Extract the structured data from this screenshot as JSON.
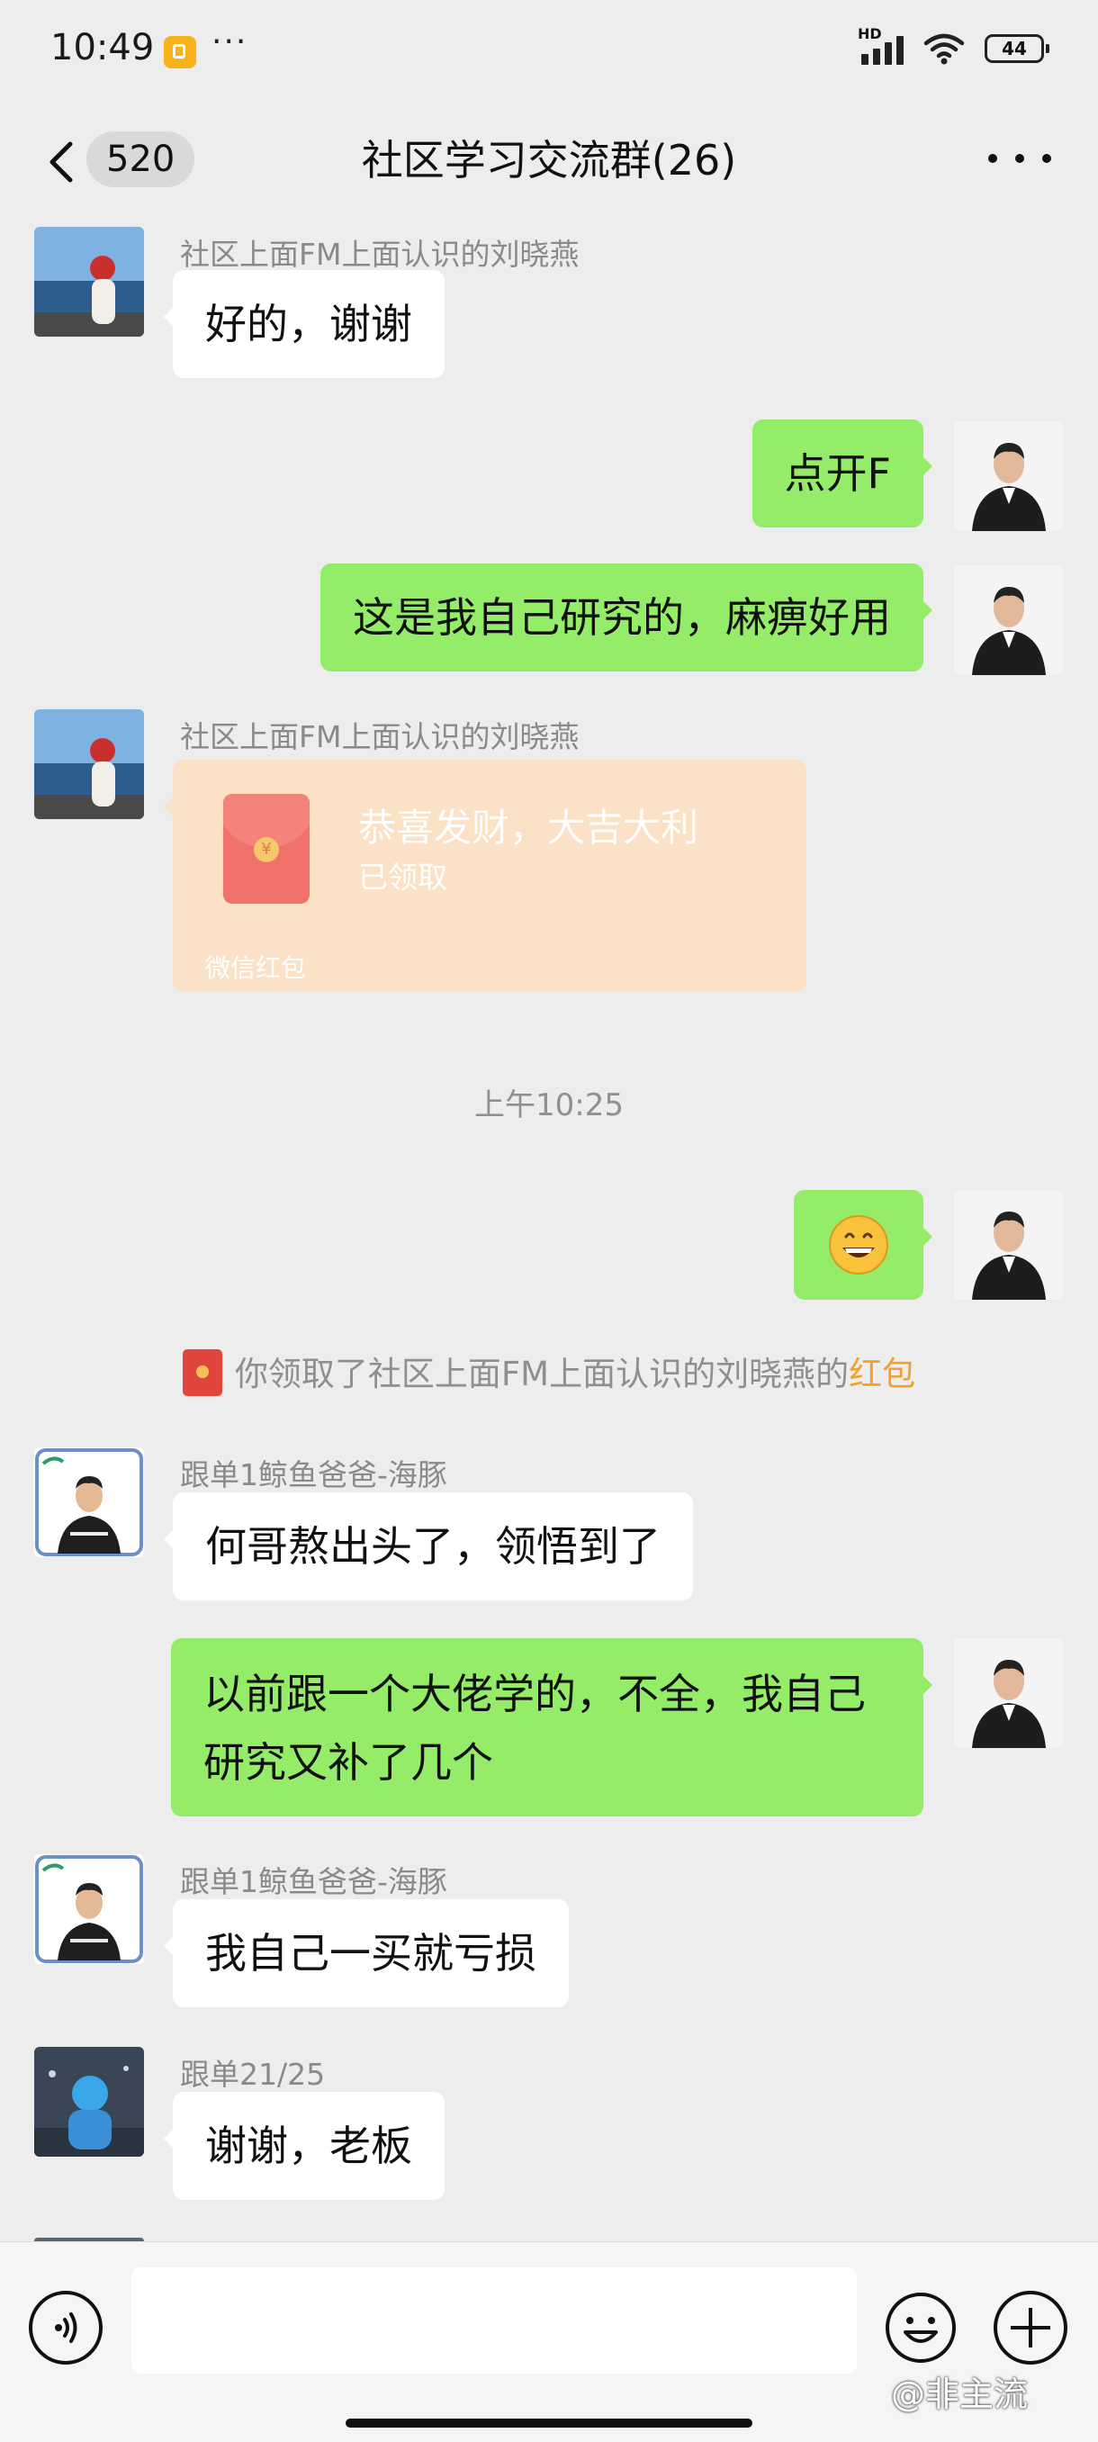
{
  "status_bar": {
    "time": "10:49",
    "more": "···",
    "network": "HD",
    "battery": "44"
  },
  "header": {
    "unread_count": "520",
    "title": "社区学习交流群(26)"
  },
  "messages": [
    {
      "side": "left",
      "sender": "社区上面FM上面认识的刘晓燕",
      "text": "好的，谢谢"
    },
    {
      "side": "right",
      "text": "点开F"
    },
    {
      "side": "right",
      "text": "这是我自己研究的，麻痹好用"
    },
    {
      "side": "left",
      "sender": "社区上面FM上面认识的刘晓燕",
      "type": "red_packet",
      "red_packet": {
        "title": "恭喜发财，大吉大利",
        "status": "已领取",
        "footer": "微信红包"
      }
    },
    {
      "type": "time",
      "text": "上午10:25"
    },
    {
      "side": "right",
      "type": "emoji",
      "text": "😄"
    },
    {
      "type": "system",
      "text": "你领取了社区上面FM上面认识的刘晓燕的",
      "highlight": "红包"
    },
    {
      "side": "left",
      "sender": "跟单1鲸鱼爸爸-海豚",
      "text": "何哥熬出头了，领悟到了"
    },
    {
      "side": "right",
      "text": "以前跟一个大佬学的，不全，我自己研究又补了几个"
    },
    {
      "side": "left",
      "sender": "跟单1鲸鱼爸爸-海豚",
      "text": "我自己一买就亏损"
    },
    {
      "side": "left",
      "sender": "跟单21/25",
      "text": "谢谢，老板"
    }
  ],
  "input_bar": {
    "placeholder": "",
    "watermark": "@非主流"
  },
  "colors": {
    "background": "#ededed",
    "self_bubble": "#95ec69",
    "other_bubble": "#ffffff",
    "red_packet": "#fbe2c6",
    "highlight": "#f0a030"
  }
}
